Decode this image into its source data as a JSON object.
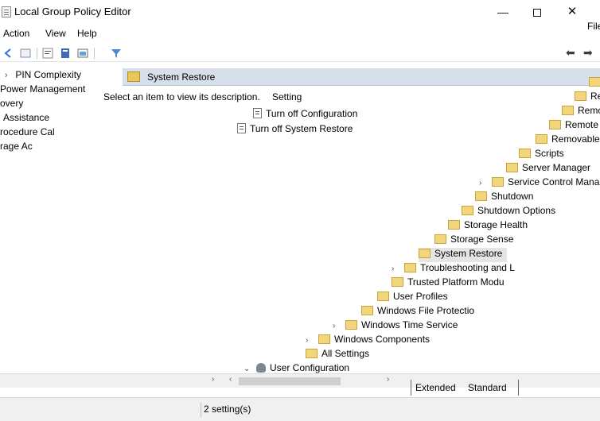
{
  "window": {
    "title": "Local Group Policy Editor",
    "minimize_glyph": "—",
    "close_glyph": "✕"
  },
  "menu": {
    "action": "Action",
    "view": "View",
    "help": "Help"
  },
  "right_edge_fragment": "File",
  "left_tree": {
    "items": [
      {
        "label": "PIN Complexity"
      },
      {
        "label": "Power Management"
      },
      {
        "label": "overy"
      },
      {
        "label": "Assistance"
      },
      {
        "label": "rocedure Cal"
      },
      {
        "label": "rage Ac"
      }
    ]
  },
  "main": {
    "header_title": "System Restore",
    "description_hint": "Select an item to view its description.",
    "setting_column": "Setting",
    "settings": [
      {
        "label": "Turn off Configuration"
      },
      {
        "label": "Turn off System Restore"
      }
    ]
  },
  "right_tree": {
    "items": [
      {
        "label": "Re"
      },
      {
        "label": "Remo"
      },
      {
        "label": "Remote"
      },
      {
        "label": "Removable"
      },
      {
        "label": "Scripts"
      },
      {
        "label": "Server Manager"
      },
      {
        "label": "Service Control Mana"
      },
      {
        "label": "Shutdown"
      },
      {
        "label": "Shutdown Options"
      },
      {
        "label": "Storage Health"
      },
      {
        "label": "Storage Sense"
      },
      {
        "label": "System Restore"
      },
      {
        "label": "Troubleshooting and L"
      },
      {
        "label": "Trusted Platform Modu"
      },
      {
        "label": "User Profiles"
      },
      {
        "label": "Windows File Protectio"
      },
      {
        "label": "Windows Time Service"
      },
      {
        "label": "Windows Components"
      },
      {
        "label": "All Settings"
      },
      {
        "label": "User Configuration"
      }
    ]
  },
  "tabs": {
    "extended": "Extended",
    "standard": "Standard"
  },
  "status": {
    "text": "2 setting(s)"
  }
}
